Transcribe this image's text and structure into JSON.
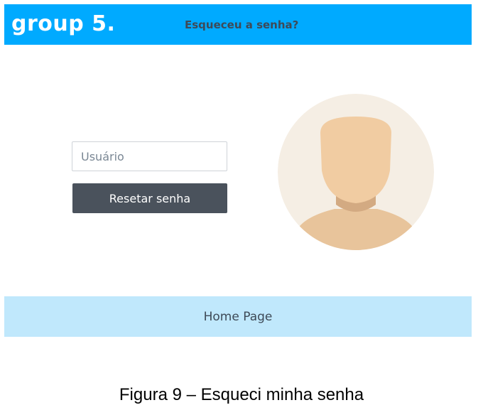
{
  "header": {
    "logo": "group 5.",
    "title": "Esqueceu a senha?"
  },
  "form": {
    "username_placeholder": "Usuário",
    "username_value": "",
    "reset_label": "Resetar senha"
  },
  "avatar": {
    "icon": "person-silhouette-icon"
  },
  "footer": {
    "home_label": "Home Page"
  },
  "caption": "Figura 9 – Esqueci minha senha",
  "colors": {
    "header_bg": "#00aaff",
    "footer_bg": "#c0e8fc",
    "button_bg": "#4a525c",
    "avatar_bg": "#f5eee4",
    "skin": "#f1cca2"
  }
}
